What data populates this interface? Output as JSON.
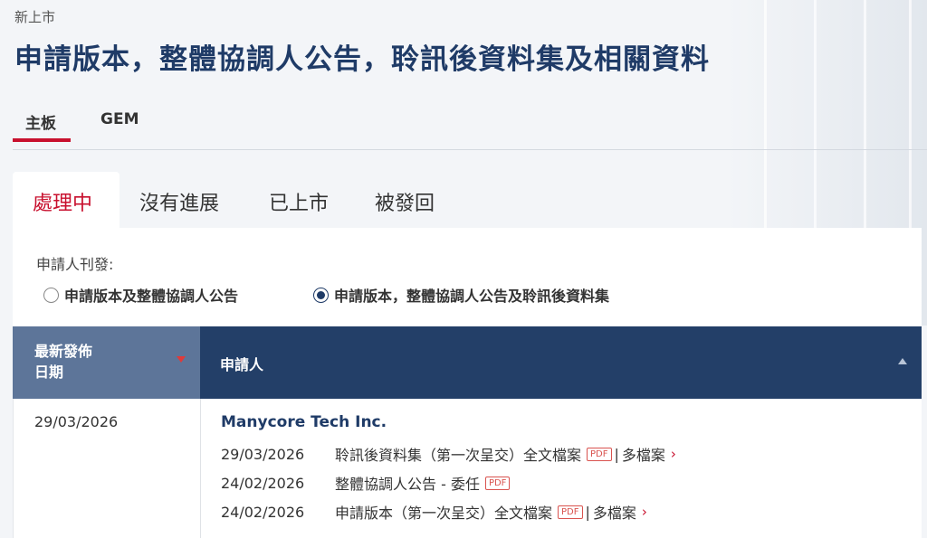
{
  "breadcrumb": "新上市",
  "title": "申請版本，整體協調人公告，聆訊後資料集及相關資料",
  "board_tabs": [
    {
      "label": "主板",
      "active": true
    },
    {
      "label": "GEM",
      "active": false
    }
  ],
  "status_tabs": [
    {
      "label": "處理中",
      "active": true
    },
    {
      "label": "沒有進展",
      "active": false
    },
    {
      "label": "已上市",
      "active": false
    },
    {
      "label": "被發回",
      "active": false
    }
  ],
  "filter": {
    "label": "申請人刊發:",
    "options": [
      {
        "label": "申請版本及整體協調人公告",
        "checked": false
      },
      {
        "label": "申請版本，整體協調人公告及聆訊後資料集",
        "checked": true
      }
    ]
  },
  "table": {
    "headers": {
      "date_line1": "最新發佈",
      "date_line2": "日期",
      "applicant": "申請人"
    },
    "rows": [
      {
        "date": "29/03/2026",
        "company": "Manycore Tech Inc.",
        "docs": [
          {
            "date": "29/03/2026",
            "title": "聆訊後資料集（第一次呈交）",
            "full_label": "全文檔案",
            "pdf": "PDF",
            "sep": "|",
            "more": "多檔案"
          },
          {
            "date": "24/02/2026",
            "title": "整體協調人公告 - 委任",
            "pdf": "PDF"
          },
          {
            "date": "24/02/2026",
            "title": "申請版本（第一次呈交）",
            "full_label": "全文檔案",
            "pdf": "PDF",
            "sep": "|",
            "more": "多檔案"
          }
        ]
      }
    ]
  },
  "colors": {
    "accent_red": "#c8102e",
    "navy": "#233f68",
    "header_light": "#5d7599",
    "title": "#1f3b67"
  }
}
